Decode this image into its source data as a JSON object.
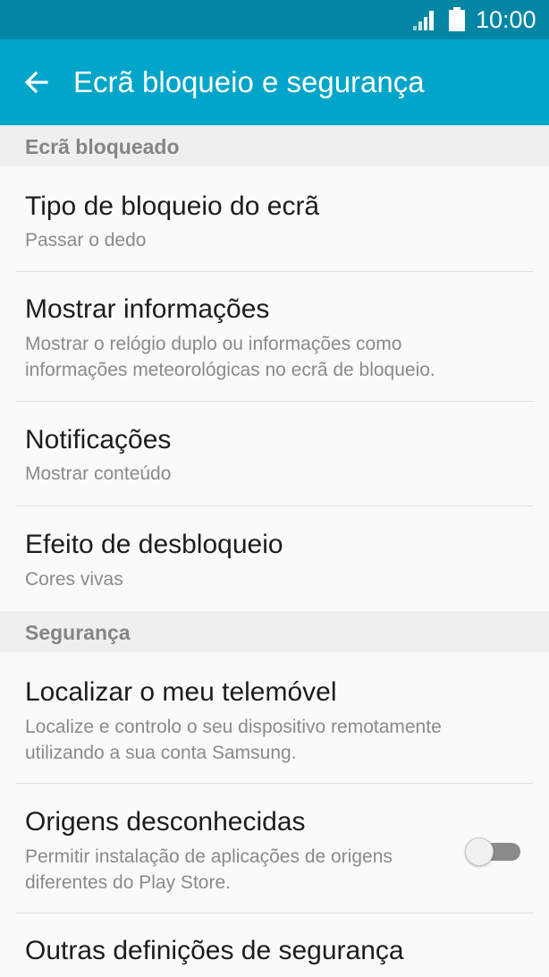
{
  "status_bar": {
    "time": "10:00",
    "signal_icon": "signal-icon",
    "battery_icon": "battery-icon"
  },
  "app_bar": {
    "title": "Ecrã bloqueio e segurança",
    "back_icon": "arrow-back-icon"
  },
  "sections": [
    {
      "header": "Ecrã bloqueado",
      "items": [
        {
          "title": "Tipo de bloqueio do ecrã",
          "subtitle": "Passar o dedo"
        },
        {
          "title": "Mostrar informações",
          "subtitle": "Mostrar o relógio duplo ou informações como informações meteorológicas no ecrã de bloqueio."
        },
        {
          "title": "Notificações",
          "subtitle": "Mostrar conteúdo"
        },
        {
          "title": "Efeito de desbloqueio",
          "subtitle": "Cores vivas"
        }
      ]
    },
    {
      "header": "Segurança",
      "items": [
        {
          "title": "Localizar o meu telemóvel",
          "subtitle": "Localize e controlo o seu dispositivo remotamente utilizando a sua conta Samsung."
        },
        {
          "title": "Origens desconhecidas",
          "subtitle": "Permitir instalação de aplicações de origens diferentes do Play Store.",
          "toggle_on": false
        },
        {
          "title": "Outras definições de segurança"
        }
      ]
    }
  ],
  "colors": {
    "status_bar": "#0386a3",
    "app_bar": "#00a5c9",
    "section_header_bg": "#efefef"
  }
}
